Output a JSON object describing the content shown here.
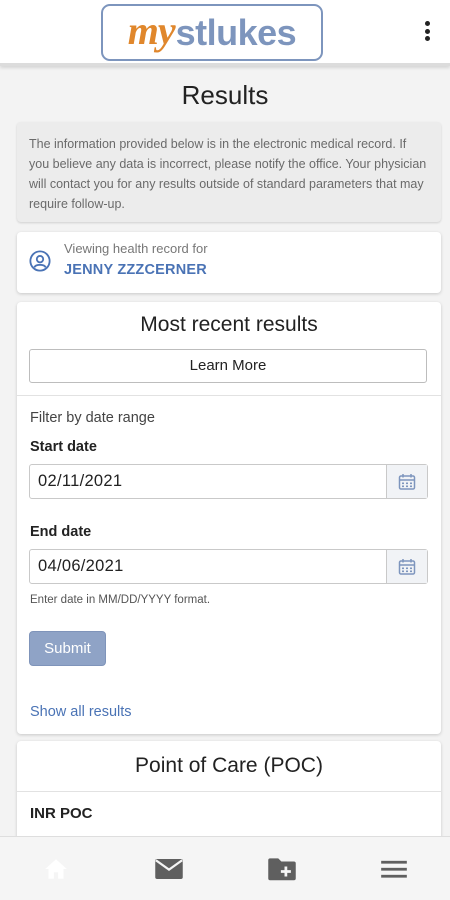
{
  "header": {
    "logo_my": "my",
    "logo_stlukes": "stlukes"
  },
  "page": {
    "title": "Results"
  },
  "notice": {
    "text": "The information provided below is in the electronic medical record.  If you believe any data is incorrect, please notify the office. Your physician will contact you for any results outside of standard parameters that may require follow-up."
  },
  "record": {
    "label": "Viewing health record for",
    "name": "JENNY ZZZCERNER"
  },
  "recent_results": {
    "title": "Most recent results",
    "learn_more_label": "Learn More",
    "filter_label": "Filter by date range",
    "start_date_label": "Start date",
    "start_date_value": "02/11/2021",
    "end_date_label": "End date",
    "end_date_value": "04/06/2021",
    "date_hint": "Enter date in MM/DD/YYYY format.",
    "submit_label": "Submit",
    "show_all_label": "Show all results"
  },
  "poc": {
    "title": "Point of Care (POC)",
    "first_item": "INR POC"
  },
  "bottom_nav": {
    "items": [
      "home-icon",
      "mail-icon",
      "folder-add-icon",
      "menu-icon"
    ]
  },
  "colors": {
    "logo_orange": "#e0872c",
    "logo_blue": "#7d95bd",
    "link_blue": "#4a73b5",
    "submit_disabled": "#8fa3c6"
  }
}
